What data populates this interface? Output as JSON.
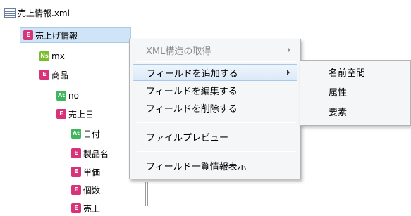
{
  "tree": {
    "nodes": [
      {
        "label": "売上情報.xml",
        "icon": "table-file-icon",
        "icon_text": ""
      },
      {
        "label": "売上げ情報",
        "icon": "element-icon",
        "icon_text": "E"
      },
      {
        "label": "mx",
        "icon": "namespace-icon",
        "icon_text": "Ns"
      },
      {
        "label": "商品",
        "icon": "element-icon",
        "icon_text": "E"
      },
      {
        "label": "no",
        "icon": "attribute-icon",
        "icon_text": "At"
      },
      {
        "label": "売上日",
        "icon": "element-icon",
        "icon_text": "E"
      },
      {
        "label": "日付",
        "icon": "attribute-icon",
        "icon_text": "At"
      },
      {
        "label": "製品名",
        "icon": "element-icon",
        "icon_text": "E"
      },
      {
        "label": "単価",
        "icon": "element-icon",
        "icon_text": "E"
      },
      {
        "label": "個数",
        "icon": "element-icon",
        "icon_text": "E"
      },
      {
        "label": "売上",
        "icon": "element-icon",
        "icon_text": "E"
      }
    ]
  },
  "context_menu": {
    "items": [
      {
        "label": "XML構造の取得",
        "disabled": true,
        "submenu": true
      },
      {
        "label": "フィールドを追加する",
        "disabled": false,
        "submenu": true,
        "hover": true
      },
      {
        "label": "フィールドを編集する",
        "disabled": false,
        "submenu": false
      },
      {
        "label": "フィールドを削除する",
        "disabled": false,
        "submenu": false
      },
      {
        "label": "ファイルプレビュー",
        "disabled": false,
        "submenu": false
      },
      {
        "label": "フィールド一覧情報表示",
        "disabled": false,
        "submenu": false
      }
    ]
  },
  "submenu": {
    "items": [
      {
        "label": "名前空間"
      },
      {
        "label": "属性"
      },
      {
        "label": "要素"
      }
    ]
  }
}
